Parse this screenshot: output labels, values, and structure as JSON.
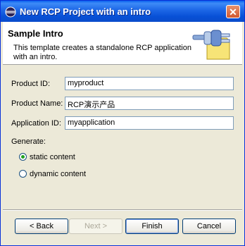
{
  "window": {
    "title": "New RCP Project with an intro",
    "close_glyph": "✕"
  },
  "header": {
    "title": "Sample Intro",
    "description": "This template creates a standalone RCP application with an intro."
  },
  "form": {
    "product_id": {
      "label": "Product ID:",
      "value": "myproduct"
    },
    "product_name": {
      "label": "Product Name:",
      "value": "RCP演示产品"
    },
    "application_id": {
      "label": "Application ID:",
      "value": "myapplication"
    }
  },
  "generate": {
    "label": "Generate:",
    "options": [
      {
        "label": "static content",
        "selected": true
      },
      {
        "label": "dynamic content",
        "selected": false
      }
    ]
  },
  "buttons": {
    "back": "< Back",
    "next": "Next >",
    "finish": "Finish",
    "cancel": "Cancel"
  },
  "colors": {
    "titlebar": "#0a4ccb",
    "dialog_bg": "#ece9d8",
    "radio_dot": "#21a121"
  }
}
